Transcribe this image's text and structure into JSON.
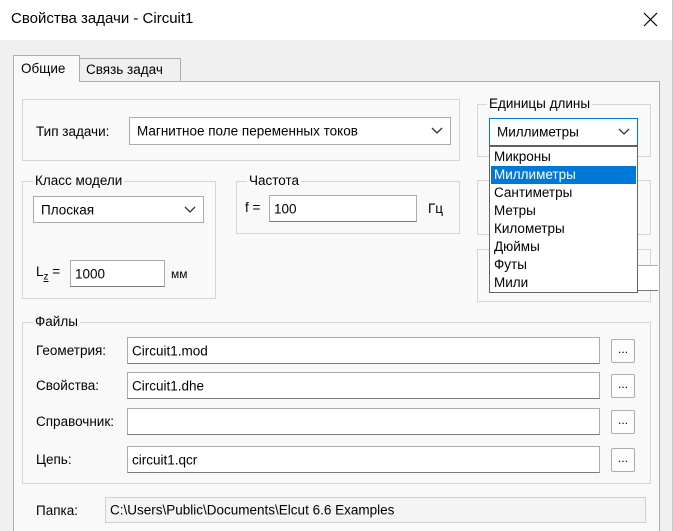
{
  "window": {
    "title": "Свойства задачи - Circuit1"
  },
  "tabs": [
    {
      "label": "Общие",
      "active": true
    },
    {
      "label": "Связь задач",
      "active": false
    }
  ],
  "problem_type": {
    "label": "Тип задачи:",
    "value": "Магнитное поле переменных токов"
  },
  "units": {
    "group_label": "Единицы длины",
    "selected": "Миллиметры",
    "options": [
      "Микроны",
      "Миллиметры",
      "Сантиметры",
      "Метры",
      "Километры",
      "Дюймы",
      "Футы",
      "Мили"
    ]
  },
  "model_class": {
    "group_label": "Класс модели",
    "value": "Плоская",
    "lz_label_main": "L",
    "lz_label_sub": "z",
    "lz_label_eq": "=",
    "lz_value": "1000",
    "lz_unit": "мм"
  },
  "frequency": {
    "group_label": "Частота",
    "f_label": "f =",
    "value": "100",
    "unit": "Гц"
  },
  "files": {
    "group_label": "Файлы",
    "rows": [
      {
        "label": "Геометрия:",
        "value": "Circuit1.mod",
        "browse": "..."
      },
      {
        "label": "Свойства:",
        "value": "Circuit1.dhe",
        "browse": "..."
      },
      {
        "label": "Справочник:",
        "value": "",
        "browse": "..."
      },
      {
        "label": "Цепь:",
        "value": "circuit1.qcr",
        "browse": "..."
      }
    ]
  },
  "folder": {
    "label": "Папка:",
    "value": "C:\\Users\\Public\\Documents\\Elcut 6.6 Examples"
  },
  "colors": {
    "accent": "#0078d7",
    "selection_text": "#ffffff"
  },
  "icons": {
    "close": "close-icon",
    "dropdown": "chevron-down-icon"
  }
}
